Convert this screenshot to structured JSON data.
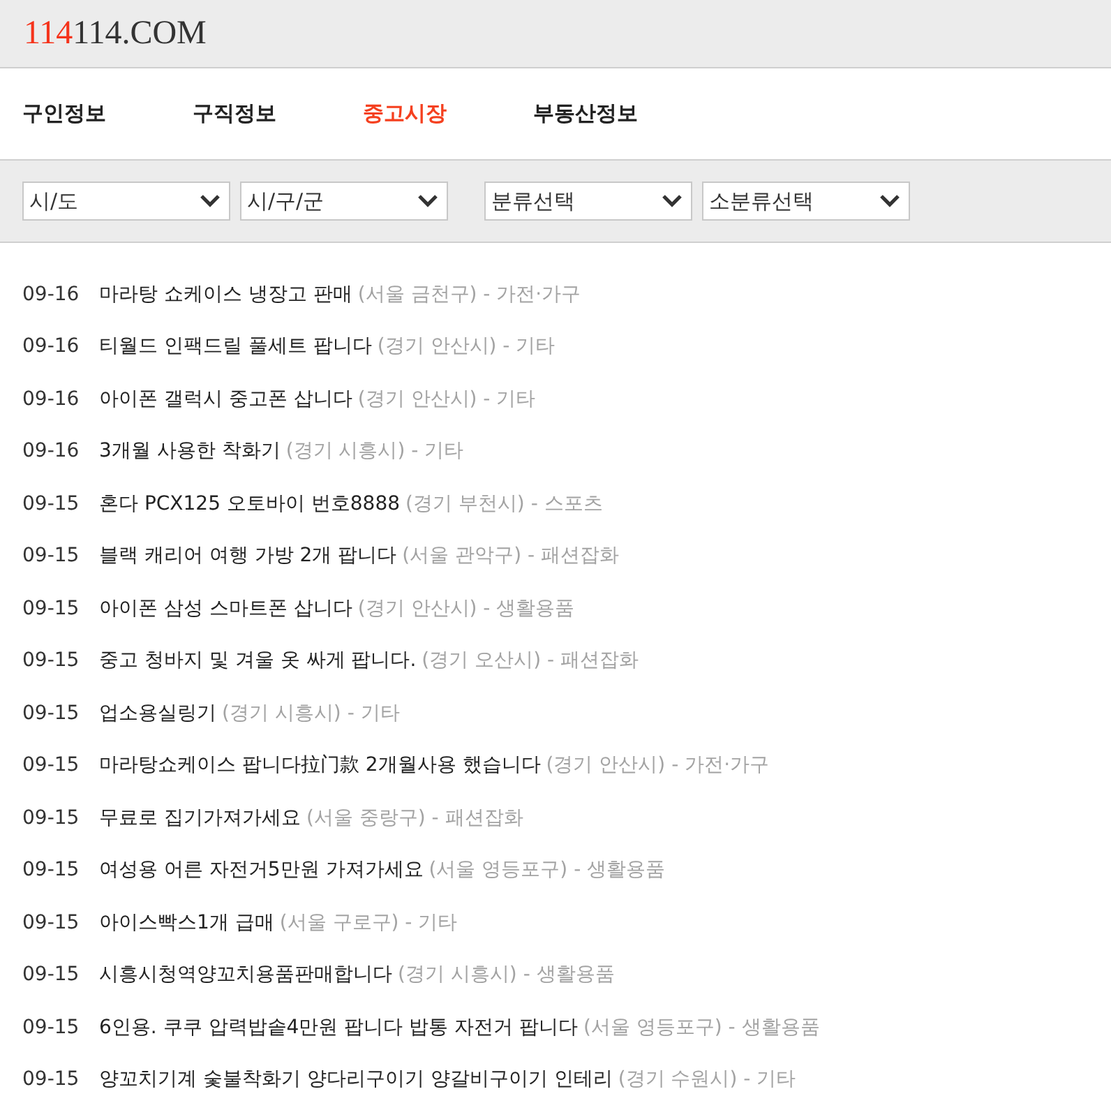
{
  "logo": {
    "accent": "114",
    "rest": "114.COM"
  },
  "nav": [
    {
      "label": "구인정보",
      "selected": false
    },
    {
      "label": "구직정보",
      "selected": false
    },
    {
      "label": "중고시장",
      "selected": true
    },
    {
      "label": "부동산정보",
      "selected": false
    }
  ],
  "filter_groups": [
    {
      "selects": [
        {
          "value": "시/도"
        },
        {
          "value": "시/구/군"
        }
      ]
    },
    {
      "selects": [
        {
          "value": "분류선택"
        },
        {
          "value": "소분류선택"
        }
      ]
    }
  ],
  "listings": [
    {
      "date": "09-16",
      "title": "마라탕 쇼케이스 냉장고 판매",
      "meta": "(서울 금천구) - 가전·가구"
    },
    {
      "date": "09-16",
      "title": "티월드 인팩드릴 풀세트 팝니다",
      "meta": "(경기 안산시) - 기타"
    },
    {
      "date": "09-16",
      "title": "아이폰 갤럭시 중고폰 삽니다",
      "meta": "(경기 안산시) - 기타"
    },
    {
      "date": "09-16",
      "title": "3개월 사용한 착화기",
      "meta": "(경기 시흥시) - 기타"
    },
    {
      "date": "09-15",
      "title": "혼다 PCX125 오토바이 번호8888",
      "meta": "(경기 부천시) - 스포츠"
    },
    {
      "date": "09-15",
      "title": "블랙 캐리어 여행 가방 2개 팝니다",
      "meta": "(서울 관악구) - 패션잡화"
    },
    {
      "date": "09-15",
      "title": "아이폰 삼성 스마트폰 삽니다",
      "meta": "(경기 안산시) - 생활용품"
    },
    {
      "date": "09-15",
      "title": "중고 청바지 및 겨울 옷 싸게 팝니다.",
      "meta": "(경기 오산시) - 패션잡화"
    },
    {
      "date": "09-15",
      "title": "업소용실링기",
      "meta": "(경기 시흥시) - 기타"
    },
    {
      "date": "09-15",
      "title": "마라탕쇼케이스 팝니다拉门款 2개월사용 했습니다",
      "meta": "(경기 안산시) - 가전·가구"
    },
    {
      "date": "09-15",
      "title": "무료로 집기가져가세요",
      "meta": "(서울 중랑구) - 패션잡화"
    },
    {
      "date": "09-15",
      "title": "여성용 어른 자전거5만원 가져가세요",
      "meta": "(서울 영등포구) - 생활용품"
    },
    {
      "date": "09-15",
      "title": "아이스빡스1개 급매",
      "meta": "(서울 구로구) - 기타"
    },
    {
      "date": "09-15",
      "title": "시흥시청역양꼬치용품판매합니다",
      "meta": "(경기 시흥시) - 생활용품"
    },
    {
      "date": "09-15",
      "title": "6인용. 쿠쿠 압력밥솥4만원 팝니다 밥통 자전거 팝니다",
      "meta": "(서울 영등포구) - 생활용품"
    },
    {
      "date": "09-15",
      "title": "양꼬치기계 숯불착화기 양다리구이기 양갈비구이기 인테리",
      "meta": "(경기 수원시) - 기타"
    }
  ]
}
